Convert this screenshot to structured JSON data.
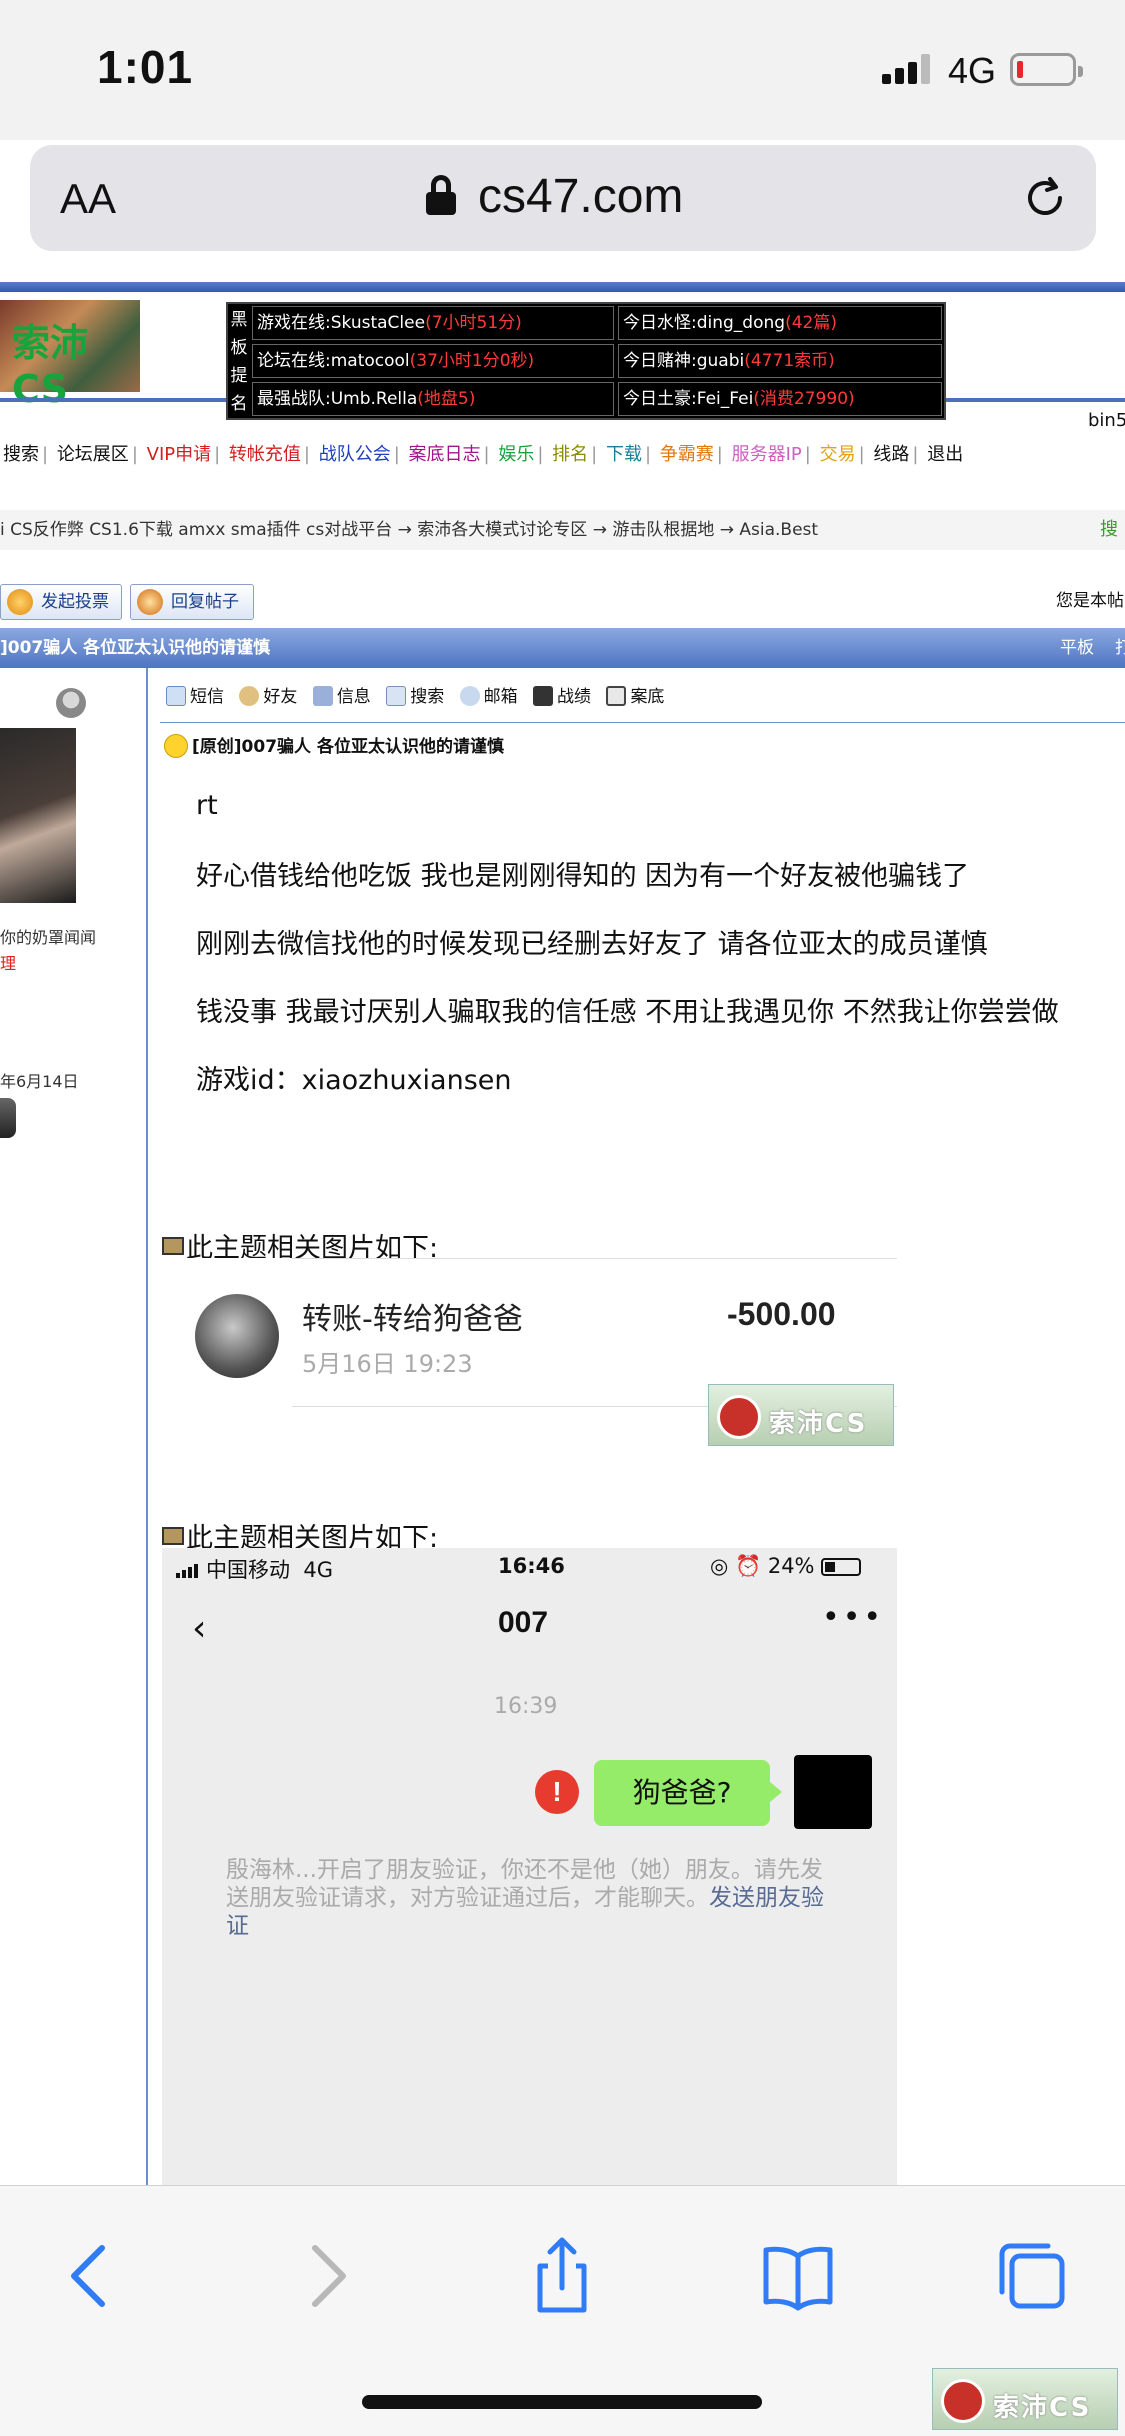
{
  "status_bar": {
    "time": "1:01",
    "network": "4G"
  },
  "browser": {
    "aa_label": "AA",
    "url": "cs47.com"
  },
  "site": {
    "logo_text": "索沛CS",
    "user_tag": "bin5",
    "board": {
      "side_label": [
        "黑",
        "板",
        "提",
        "名"
      ],
      "rows": [
        {
          "left_label": "游戏在线:SkustaClee",
          "left_value": "(7小时51分)",
          "right_label": "今日水怪:ding_dong",
          "right_value": "(42篇)"
        },
        {
          "left_label": "论坛在线:matocool",
          "left_value": "(37小时1分0秒)",
          "right_label": "今日赌神:guabi",
          "right_value": "(4771索币)"
        },
        {
          "left_label": "最强战队:Umb.Rella",
          "left_value": "(地盘5)",
          "right_label": "今日土豪:Fei_Fei",
          "right_value": "(消费27990)"
        }
      ]
    },
    "nav": [
      {
        "label": "搜索",
        "color": "#111111"
      },
      {
        "label": "论坛展区",
        "color": "#111111"
      },
      {
        "label": "VIP申请",
        "color": "#d31f1f"
      },
      {
        "label": "转帐充值",
        "color": "#d31f1f"
      },
      {
        "label": "战队公会",
        "color": "#1f3fc0"
      },
      {
        "label": "案底日志",
        "color": "#a0148c"
      },
      {
        "label": "娱乐",
        "color": "#18a43c"
      },
      {
        "label": "排名",
        "color": "#8c8c00"
      },
      {
        "label": "下载",
        "color": "#1a7f9a"
      },
      {
        "label": "争霸赛",
        "color": "#e07a10"
      },
      {
        "label": "服务器IP",
        "color": "#d060c0"
      },
      {
        "label": "交易",
        "color": "#e0a010"
      },
      {
        "label": "线路",
        "color": "#111111"
      },
      {
        "label": "退出",
        "color": "#111111"
      }
    ],
    "breadcrumb": "i CS反作弊 CS1.6下载 amxx sma插件 cs对战平台 → 索沛各大模式讨论专区 → 游击队根据地 → Asia.Best",
    "search_label": "搜",
    "buttons": {
      "new_poll": "发起投票",
      "reply": "回复帖子"
    },
    "you_are_label": "您是本帖",
    "thread_title": "]007骗人 各位亚太认识他的请谨慎",
    "title_bar_right": [
      "平板",
      "打"
    ]
  },
  "post": {
    "author_note": "你的奶罩闻闻",
    "author_red": "理",
    "reg_date": "年6月14日",
    "tools": [
      "短信",
      "好友",
      "信息",
      "搜索",
      "邮箱",
      "战绩",
      "案底"
    ],
    "title": "[原创]007骗人 各位亚太认识他的请谨慎",
    "lines": [
      "rt",
      "好心借钱给他吃饭 我也是刚刚得知的 因为有一个好友被他骗钱了",
      "刚刚去微信找他的时候发现已经删去好友了 请各位亚太的成员谨慎",
      "钱没事 我最讨厌别人骗取我的信任感 不用让我遇见你 不然我让你尝尝做",
      "游戏id：xiaozhuxiansen"
    ],
    "attachment_heading": "此主题相关图片如下:"
  },
  "image1": {
    "title": "转账-转给狗爸爸",
    "date": "5月16日 19:23",
    "amount": "-500.00",
    "watermark": "索沛CS"
  },
  "image2": {
    "carrier": "中国移动",
    "network": "4G",
    "time": "16:46",
    "battery": "24%",
    "contact": "007",
    "message_time": "16:39",
    "message": "狗爸爸?",
    "notice": "殷海林...开启了朋友验证，你还不是他（她）朋友。请先发送朋友验证请求，对方验证通过后，才能聊天。",
    "notice_link": "发送朋友验证"
  },
  "watermark_bottom": "索沛CS"
}
